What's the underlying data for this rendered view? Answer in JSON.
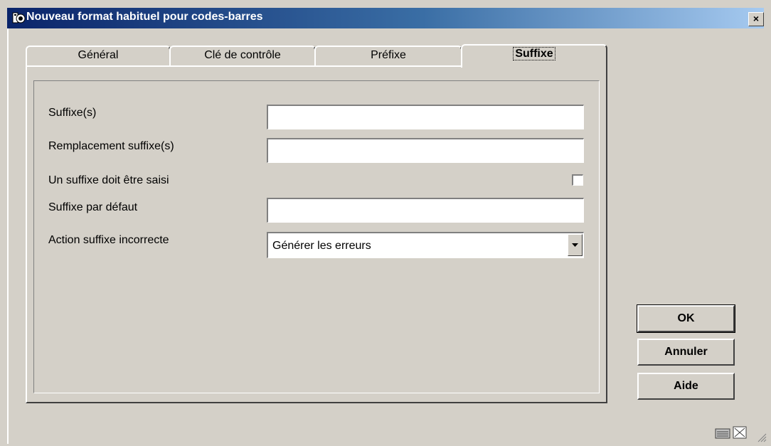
{
  "window": {
    "title": "Nouveau format habituel pour codes-barres",
    "close_label": "×",
    "icon": "app-logo-icon"
  },
  "tabs": [
    {
      "label": "Général",
      "active": false
    },
    {
      "label": "Clé de contrôle",
      "active": false
    },
    {
      "label": "Préfixe",
      "active": false
    },
    {
      "label": "Suffixe",
      "active": true
    }
  ],
  "form": {
    "suffixes_label": "Suffixe(s)",
    "suffixes_value": "",
    "replacement_label": "Remplacement suffixe(s)",
    "replacement_value": "",
    "required_label": "Un suffixe doit être saisi",
    "required_checked": false,
    "default_label": "Suffixe par défaut",
    "default_value": "",
    "invalid_action_label": "Action suffixe incorrecte",
    "invalid_action_value": "Générer les erreurs"
  },
  "buttons": {
    "ok": "OK",
    "cancel": "Annuler",
    "help": "Aide"
  },
  "status_bar": {
    "icons": [
      "keyboard-icon",
      "maximize-icon",
      "resize-grip-icon"
    ]
  }
}
